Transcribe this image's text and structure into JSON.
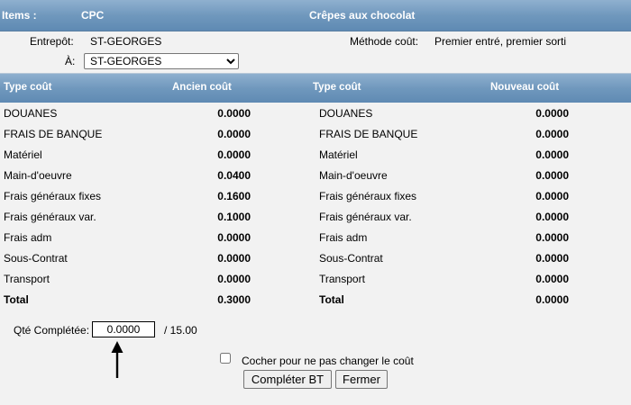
{
  "header": {
    "items_label": "Items :",
    "item_code": "CPC",
    "item_name": "Crêpes aux chocolat"
  },
  "form": {
    "entrepot_label": "Entrepôt:",
    "entrepot_value": "ST-GEORGES",
    "methode_label": "Méthode coût:",
    "methode_value": "Premier entré, premier sorti",
    "a_label": "À:",
    "a_selected": "ST-GEORGES"
  },
  "table": {
    "headers": {
      "type_left": "Type coût",
      "ancien": "Ancien coût",
      "type_right": "Type coût",
      "nouveau": "Nouveau coût"
    },
    "rows": [
      {
        "type": "DOUANES",
        "ancien": "0.0000",
        "nouveau": "0.0000"
      },
      {
        "type": "FRAIS DE BANQUE",
        "ancien": "0.0000",
        "nouveau": "0.0000"
      },
      {
        "type": "Matériel",
        "ancien": "0.0000",
        "nouveau": "0.0000"
      },
      {
        "type": "Main-d'oeuvre",
        "ancien": "0.0400",
        "nouveau": "0.0000"
      },
      {
        "type": "Frais généraux fixes",
        "ancien": "0.1600",
        "nouveau": "0.0000"
      },
      {
        "type": "Frais généraux var.",
        "ancien": "0.1000",
        "nouveau": "0.0000"
      },
      {
        "type": "Frais adm",
        "ancien": "0.0000",
        "nouveau": "0.0000"
      },
      {
        "type": "Sous-Contrat",
        "ancien": "0.0000",
        "nouveau": "0.0000"
      },
      {
        "type": "Transport",
        "ancien": "0.0000",
        "nouveau": "0.0000"
      },
      {
        "type": "Total",
        "ancien": "0.3000",
        "nouveau": "0.0000"
      }
    ]
  },
  "qte": {
    "label": "Qté Complétée:",
    "value": "0.0000",
    "total": "/ 15.00"
  },
  "checkbox": {
    "label": "Cocher pour ne pas changer le coût",
    "checked": false
  },
  "buttons": {
    "complete": "Compléter BT",
    "close": "Fermer"
  }
}
